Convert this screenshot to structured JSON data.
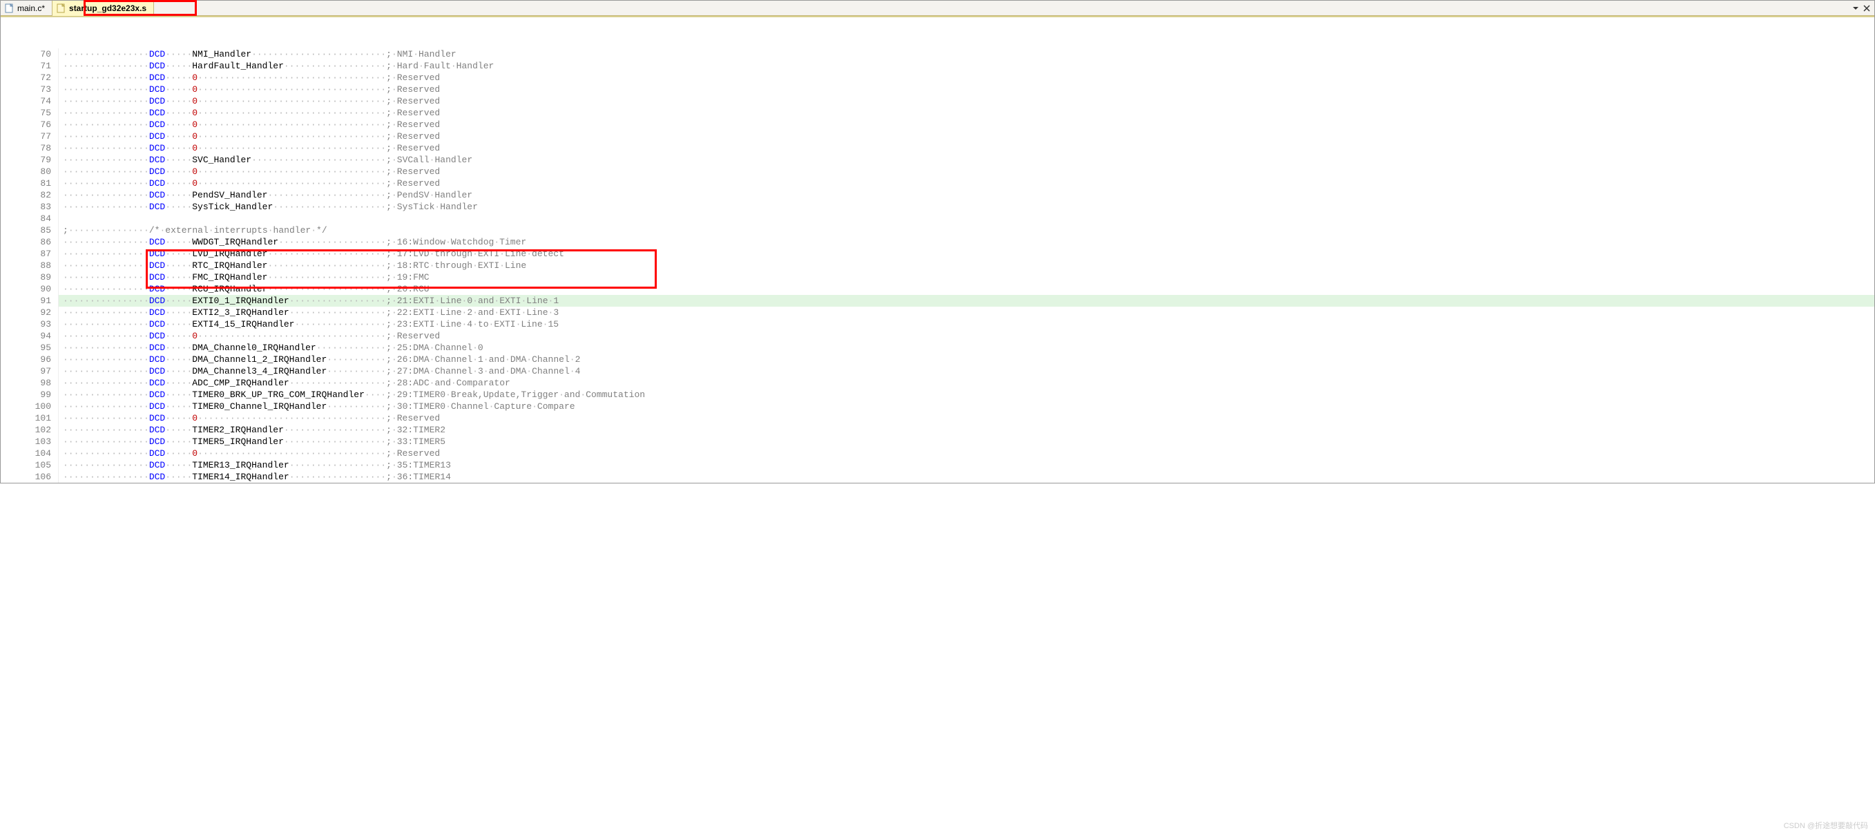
{
  "tabs": [
    {
      "label": "main.c*",
      "active": false
    },
    {
      "label": "startup_gd32e23x.s",
      "active": true
    }
  ],
  "watermark": "CSDN @折途想要敲代码",
  "dcd": "DCD",
  "comment_block": "/* external interrupts handler */",
  "lines": [
    {
      "n": 70,
      "t": "dcd",
      "val": "NMI_Handler",
      "cmt": "; NMI Handler"
    },
    {
      "n": 71,
      "t": "dcd",
      "val": "HardFault_Handler",
      "cmt": "; Hard Fault Handler"
    },
    {
      "n": 72,
      "t": "dcd",
      "val": "0",
      "cmt": "; Reserved"
    },
    {
      "n": 73,
      "t": "dcd",
      "val": "0",
      "cmt": "; Reserved"
    },
    {
      "n": 74,
      "t": "dcd",
      "val": "0",
      "cmt": "; Reserved"
    },
    {
      "n": 75,
      "t": "dcd",
      "val": "0",
      "cmt": "; Reserved"
    },
    {
      "n": 76,
      "t": "dcd",
      "val": "0",
      "cmt": "; Reserved"
    },
    {
      "n": 77,
      "t": "dcd",
      "val": "0",
      "cmt": "; Reserved"
    },
    {
      "n": 78,
      "t": "dcd",
      "val": "0",
      "cmt": "; Reserved"
    },
    {
      "n": 79,
      "t": "dcd",
      "val": "SVC_Handler",
      "cmt": "; SVCall Handler"
    },
    {
      "n": 80,
      "t": "dcd",
      "val": "0",
      "cmt": "; Reserved"
    },
    {
      "n": 81,
      "t": "dcd",
      "val": "0",
      "cmt": "; Reserved"
    },
    {
      "n": 82,
      "t": "dcd",
      "val": "PendSV_Handler",
      "cmt": "; PendSV Handler"
    },
    {
      "n": 83,
      "t": "dcd",
      "val": "SysTick_Handler",
      "cmt": "; SysTick Handler"
    },
    {
      "n": 84,
      "t": "blank"
    },
    {
      "n": 85,
      "t": "comment"
    },
    {
      "n": 86,
      "t": "dcd",
      "val": "WWDGT_IRQHandler",
      "cmt": "; 16:Window Watchdog Timer"
    },
    {
      "n": 87,
      "t": "dcd",
      "val": "LVD_IRQHandler",
      "cmt": "; 17:LVD through EXTI Line detect"
    },
    {
      "n": 88,
      "t": "dcd",
      "val": "RTC_IRQHandler",
      "cmt": "; 18:RTC through EXTI Line"
    },
    {
      "n": 89,
      "t": "dcd",
      "val": "FMC_IRQHandler",
      "cmt": "; 19:FMC"
    },
    {
      "n": 90,
      "t": "dcd",
      "val": "RCU_IRQHandler",
      "cmt": "; 20:RCU"
    },
    {
      "n": 91,
      "t": "dcd",
      "val": "EXTI0_1_IRQHandler",
      "cmt": "; 21:EXTI Line 0 and EXTI Line 1",
      "hl": true
    },
    {
      "n": 92,
      "t": "dcd",
      "val": "EXTI2_3_IRQHandler",
      "cmt": "; 22:EXTI Line 2 and EXTI Line 3"
    },
    {
      "n": 93,
      "t": "dcd",
      "val": "EXTI4_15_IRQHandler",
      "cmt": "; 23:EXTI Line 4 to EXTI Line 15"
    },
    {
      "n": 94,
      "t": "dcd",
      "val": "0",
      "cmt": "; Reserved"
    },
    {
      "n": 95,
      "t": "dcd",
      "val": "DMA_Channel0_IRQHandler",
      "cmt": "; 25:DMA Channel 0"
    },
    {
      "n": 96,
      "t": "dcd",
      "val": "DMA_Channel1_2_IRQHandler",
      "cmt": "; 26:DMA Channel 1 and DMA Channel 2"
    },
    {
      "n": 97,
      "t": "dcd",
      "val": "DMA_Channel3_4_IRQHandler",
      "cmt": "; 27:DMA Channel 3 and DMA Channel 4"
    },
    {
      "n": 98,
      "t": "dcd",
      "val": "ADC_CMP_IRQHandler",
      "cmt": "; 28:ADC and Comparator"
    },
    {
      "n": 99,
      "t": "dcd",
      "val": "TIMER0_BRK_UP_TRG_COM_IRQHandler",
      "cmt": "; 29:TIMER0 Break,Update,Trigger and Commutation"
    },
    {
      "n": 100,
      "t": "dcd",
      "val": "TIMER0_Channel_IRQHandler",
      "cmt": "; 30:TIMER0 Channel Capture Compare"
    },
    {
      "n": 101,
      "t": "dcd",
      "val": "0",
      "cmt": "; Reserved"
    },
    {
      "n": 102,
      "t": "dcd",
      "val": "TIMER2_IRQHandler",
      "cmt": "; 32:TIMER2"
    },
    {
      "n": 103,
      "t": "dcd",
      "val": "TIMER5_IRQHandler",
      "cmt": "; 33:TIMER5"
    },
    {
      "n": 104,
      "t": "dcd",
      "val": "0",
      "cmt": "; Reserved"
    },
    {
      "n": 105,
      "t": "dcd",
      "val": "TIMER13_IRQHandler",
      "cmt": "; 35:TIMER13"
    },
    {
      "n": 106,
      "t": "dcd",
      "val": "TIMER14_IRQHandler",
      "cmt": "; 36:TIMER14"
    }
  ]
}
